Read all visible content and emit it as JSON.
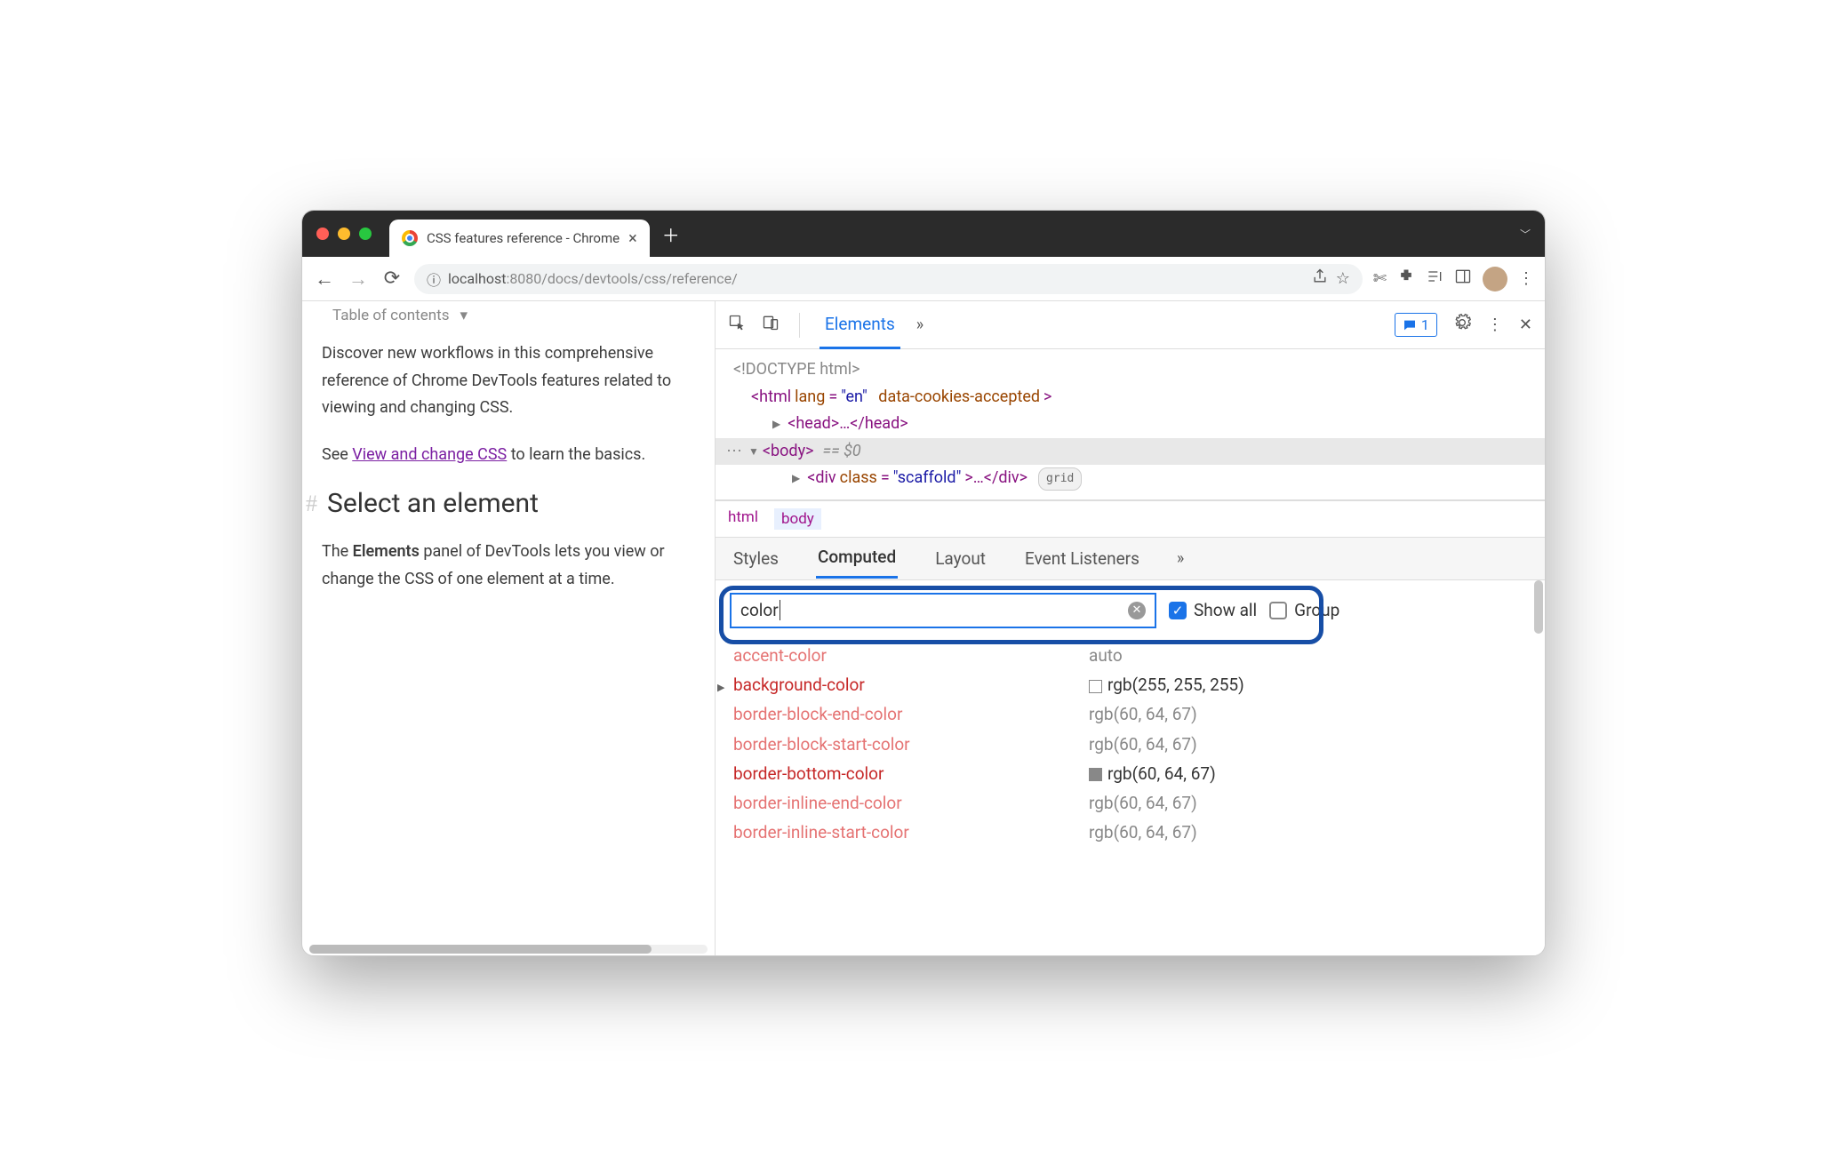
{
  "browser": {
    "tab_title": "CSS features reference - Chrome",
    "url_host": "localhost",
    "url_port": ":8080",
    "url_path": "/docs/devtools/css/reference/",
    "toc_label": "Table of contents",
    "para1": "Discover new workflows in this comprehensive reference of Chrome DevTools features related to viewing and changing CSS.",
    "para2_a": "See ",
    "para2_link": "View and change CSS",
    "para2_b": " to learn the basics.",
    "h2": "Select an element",
    "para3_a": "The ",
    "para3_bold": "Elements",
    "para3_b": " panel of DevTools lets you view or change the CSS of one element at a time."
  },
  "devtools": {
    "tabs": {
      "active": "Elements",
      "badge_count": "1"
    },
    "dom": {
      "doctype": "<!DOCTYPE html>",
      "html_open": "<html ",
      "html_attr1": "lang",
      "html_val1": "\"en\"",
      "html_attr2": "data-cookies-accepted",
      "html_close": ">",
      "head": "<head>…</head>",
      "body_open": "<body>",
      "eq0": "== $0",
      "div_open": "<div ",
      "div_attr": "class",
      "div_val": "\"scaffold\"",
      "div_close": ">…</div>",
      "grid_pill": "grid"
    },
    "crumbs": [
      "html",
      "body"
    ],
    "subtabs": [
      "Styles",
      "Computed",
      "Layout",
      "Event Listeners"
    ],
    "filter": {
      "value": "color",
      "show_all_label": "Show all",
      "show_all_checked": true,
      "group_label": "Group",
      "group_checked": false
    },
    "props": [
      {
        "name": "accent-color",
        "value": "auto",
        "light": true,
        "swatch": ""
      },
      {
        "name": "background-color",
        "value": "rgb(255, 255, 255)",
        "expand": true,
        "swatch": "white"
      },
      {
        "name": "border-block-end-color",
        "value": "rgb(60, 64, 67)",
        "light": true,
        "swatch": ""
      },
      {
        "name": "border-block-start-color",
        "value": "rgb(60, 64, 67)",
        "light": true,
        "swatch": ""
      },
      {
        "name": "border-bottom-color",
        "value": "rgb(60, 64, 67)",
        "swatch": "grey"
      },
      {
        "name": "border-inline-end-color",
        "value": "rgb(60, 64, 67)",
        "light": true,
        "swatch": ""
      },
      {
        "name": "border-inline-start-color",
        "value": "rgb(60, 64, 67)",
        "light": true,
        "swatch": ""
      }
    ]
  }
}
